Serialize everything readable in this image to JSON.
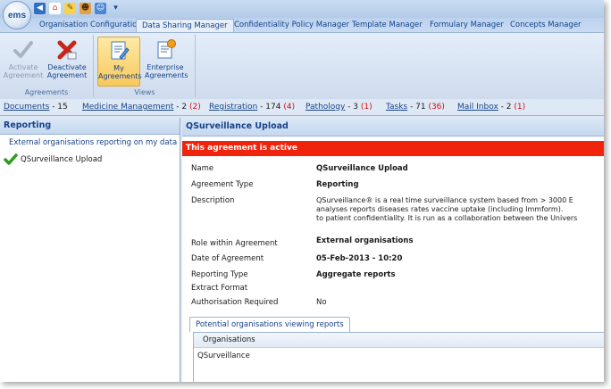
{
  "app": {
    "logo_text": "ems"
  },
  "tabs": [
    {
      "label": "Organisation Configuration",
      "active": false
    },
    {
      "label": "Data Sharing Manager",
      "active": true
    },
    {
      "label": "Confidentiality Policy Manager",
      "active": false
    },
    {
      "label": "Template Manager",
      "active": false
    },
    {
      "label": "Formulary Manager",
      "active": false
    },
    {
      "label": "Concepts Manager",
      "active": false
    }
  ],
  "ribbon": {
    "groups": [
      {
        "label": "Agreements",
        "buttons": [
          {
            "line1": "Activate",
            "line2": "Agreement",
            "icon": "checkmark-icon",
            "enabled": false
          },
          {
            "line1": "Deactivate",
            "line2": "Agreement",
            "icon": "red-x-icon",
            "enabled": true
          }
        ]
      },
      {
        "label": "Views",
        "buttons": [
          {
            "line1": "My",
            "line2": "Agreements",
            "icon": "document-pencil-icon",
            "selected": true
          },
          {
            "line1": "Enterprise",
            "line2": "Agreements",
            "icon": "document-star-icon",
            "selected": false
          }
        ]
      }
    ]
  },
  "status_links": [
    {
      "label": "Documents",
      "count": "- 15",
      "alert": ""
    },
    {
      "label": "Medicine Management",
      "count": "- 2",
      "alert": "(2)"
    },
    {
      "label": "Registration",
      "count": "- 174",
      "alert": "(4)"
    },
    {
      "label": "Pathology",
      "count": "- 3",
      "alert": "(1)"
    },
    {
      "label": "Tasks",
      "count": "- 71",
      "alert": "(36)"
    },
    {
      "label": "Mail Inbox",
      "count": "- 2",
      "alert": "(1)"
    }
  ],
  "left_panel": {
    "title": "Reporting",
    "subtitle": "External organisations reporting on my data",
    "items": [
      {
        "label": "QSurveillance Upload",
        "icon": "green-check-icon"
      }
    ]
  },
  "detail": {
    "title": "QSurveillance Upload",
    "status_banner": "This agreement is active",
    "fields": {
      "name_label": "Name",
      "name_value": "QSurveillance Upload",
      "type_label": "Agreement Type",
      "type_value": "Reporting",
      "description_label": "Description",
      "description_lines": [
        "QSurveillance® is a real time surveillance system based from > 3000 E",
        "analyses  reports diseases rates  vaccine uptake (including Immform).",
        "to patient confidentiality. It is run as a collaboration between the Univers"
      ],
      "role_label": "Role within Agreement",
      "role_value": "External organisations",
      "date_label": "Date of Agreement",
      "date_value": "05-Feb-2013 - 10:20",
      "reporting_label": "Reporting Type",
      "reporting_value": "Aggregate reports",
      "extract_label": "Extract Format",
      "auth_label": "Authorisation Required",
      "auth_value": "No"
    },
    "subtab_label": "Potential organisations viewing reports",
    "org_column": "Organisations",
    "org_rows": [
      "QSurveillance"
    ]
  }
}
